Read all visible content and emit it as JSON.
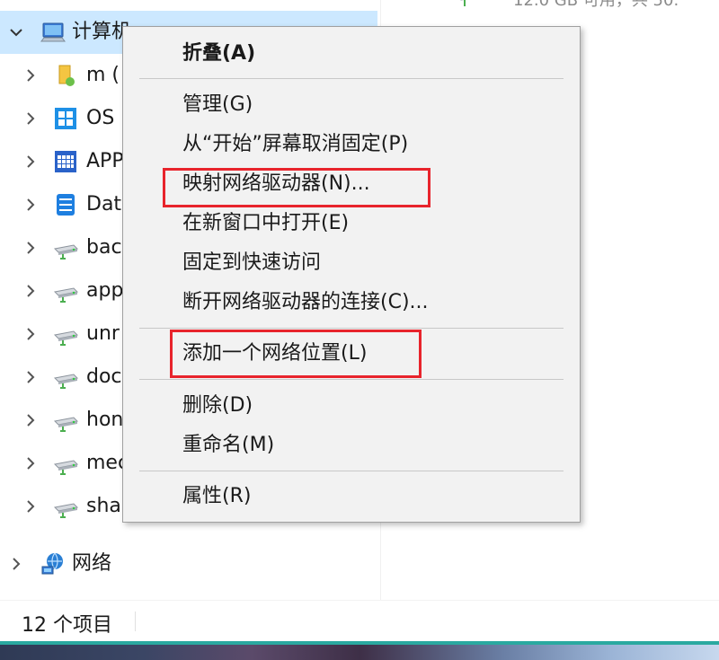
{
  "nav": {
    "computer_label": "计算机",
    "items": [
      {
        "label": "m (",
        "icon": "user-folder-icon"
      },
      {
        "label": "OS",
        "icon": "windows-drive-icon"
      },
      {
        "label": "APP",
        "icon": "app-drive-icon"
      },
      {
        "label": "Dat",
        "icon": "data-drive-icon"
      },
      {
        "label": "bac",
        "icon": "network-drive-icon"
      },
      {
        "label": "app",
        "icon": "network-drive-icon"
      },
      {
        "label": "unr",
        "icon": "network-drive-icon"
      },
      {
        "label": "doc",
        "icon": "network-drive-icon"
      },
      {
        "label": "hon",
        "icon": "network-drive-icon"
      },
      {
        "label": "mec",
        "icon": "network-drive-icon"
      },
      {
        "label": "sha",
        "icon": "network-drive-icon"
      }
    ],
    "network_label": "网络"
  },
  "content": {
    "drive_fragment": "12.0 GB 可用，共 50."
  },
  "status_bar": {
    "item_count": "12 个项目"
  },
  "context_menu": {
    "items": [
      {
        "label": "折叠(A)",
        "bold": true
      },
      {
        "label": "管理(G)"
      },
      {
        "label": "从“开始”屏幕取消固定(P)"
      },
      {
        "label": "映射网络驱动器(N)...",
        "highlighted": true
      },
      {
        "label": "在新窗口中打开(E)"
      },
      {
        "label": "固定到快速访问"
      },
      {
        "label": "断开网络驱动器的连接(C)..."
      },
      {
        "label": "添加一个网络位置(L)",
        "highlighted": true
      },
      {
        "label": "删除(D)"
      },
      {
        "label": "重命名(M)"
      },
      {
        "label": "属性(R)"
      }
    ]
  },
  "colors": {
    "selection": "#cce8ff",
    "highlight_border": "#e8242c",
    "menu_bg": "#f2f2f2"
  }
}
